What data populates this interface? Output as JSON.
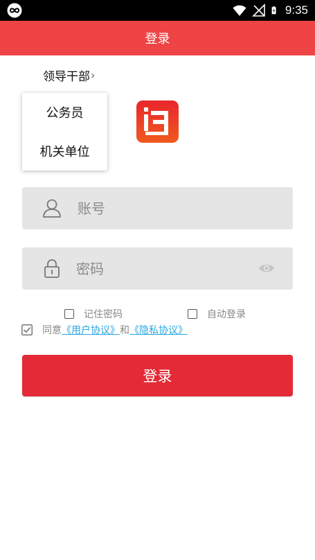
{
  "status_bar": {
    "time": "9:35",
    "icons": [
      "app-notification-icon",
      "wifi-icon",
      "signal-icon",
      "battery-charging-icon"
    ]
  },
  "header": {
    "title": "登录"
  },
  "role_selector": {
    "selected": "领导干部",
    "chevron": "›",
    "options": [
      "公务员",
      "机关单位"
    ]
  },
  "form": {
    "account_placeholder": "账号",
    "account_value": "",
    "password_placeholder": "密码",
    "password_value": "",
    "remember_label": "记住密码",
    "remember_checked": false,
    "autologin_label": "自动登录",
    "autologin_checked": false,
    "agree_checked": true,
    "agree_prefix": "同意",
    "user_agreement": "《用户协议》",
    "and": "和",
    "privacy_policy": "《隐私协议》",
    "submit_label": "登录"
  },
  "colors": {
    "header_bg": "#ee4446",
    "button_bg": "#e32a36",
    "field_bg": "#e5e5e5",
    "link": "#2aa6e0",
    "logo_top": "#e8262d",
    "logo_bottom": "#f05a1e"
  }
}
